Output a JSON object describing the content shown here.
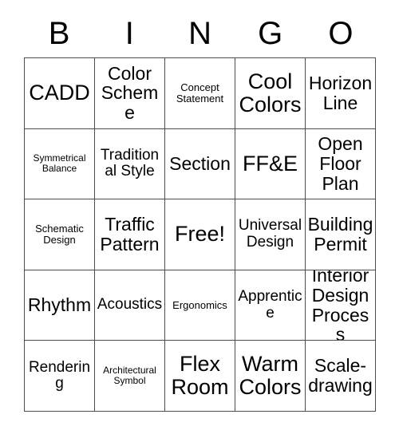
{
  "card": {
    "header_letters": [
      "B",
      "I",
      "N",
      "G",
      "O"
    ],
    "rows": [
      [
        {
          "text": "CADD",
          "size": "s-xl"
        },
        {
          "text": "Color Scheme",
          "size": "s-lg"
        },
        {
          "text": "Concept Statement",
          "size": "s-sm"
        },
        {
          "text": "Cool Colors",
          "size": "s-xl"
        },
        {
          "text": "Horizon Line",
          "size": "s-lg"
        }
      ],
      [
        {
          "text": "Symmetrical Balance",
          "size": "s-xs"
        },
        {
          "text": "Traditional Style",
          "size": "s-md"
        },
        {
          "text": "Section",
          "size": "s-lg"
        },
        {
          "text": "FF&E",
          "size": "s-xl"
        },
        {
          "text": "Open Floor Plan",
          "size": "s-lg"
        }
      ],
      [
        {
          "text": "Schematic Design",
          "size": "s-sm"
        },
        {
          "text": "Traffic Pattern",
          "size": "s-lg"
        },
        {
          "text": "Free!",
          "size": "s-xl"
        },
        {
          "text": "Universal Design",
          "size": "s-md"
        },
        {
          "text": "Building Permit",
          "size": "s-lg"
        }
      ],
      [
        {
          "text": "Rhythm",
          "size": "s-lg"
        },
        {
          "text": "Acoustics",
          "size": "s-md"
        },
        {
          "text": "Ergonomics",
          "size": "s-sm"
        },
        {
          "text": "Apprentice",
          "size": "s-md"
        },
        {
          "text": "Interior Design Process",
          "size": "s-lg"
        }
      ],
      [
        {
          "text": "Rendering",
          "size": "s-md"
        },
        {
          "text": "Architectural Symbol",
          "size": "s-xs"
        },
        {
          "text": "Flex Room",
          "size": "s-xl"
        },
        {
          "text": "Warm Colors",
          "size": "s-xl"
        },
        {
          "text": "Scale-drawing",
          "size": "s-lg"
        }
      ]
    ]
  },
  "colors": {
    "background": "#ffffff",
    "text": "#000000",
    "grid_line": "#4d4d4d"
  }
}
